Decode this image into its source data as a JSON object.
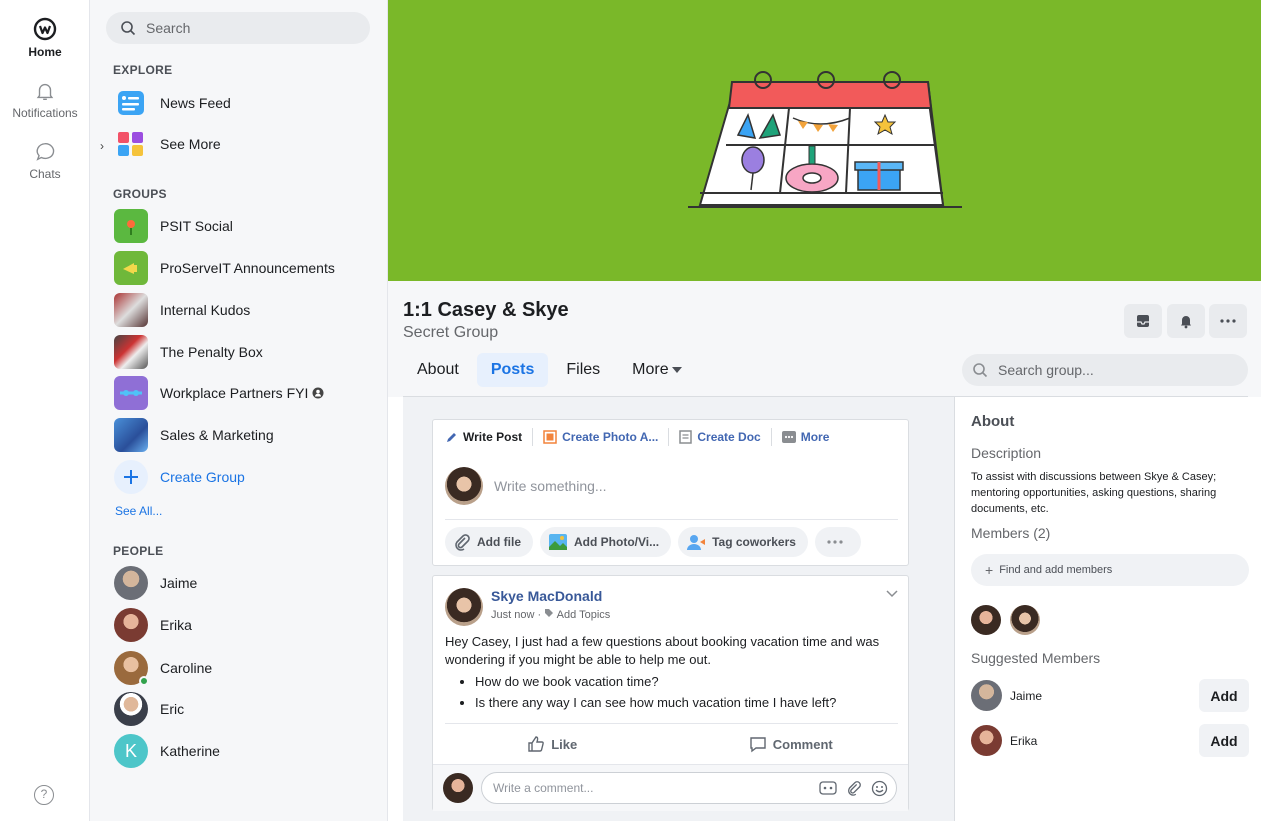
{
  "rail": {
    "home": "Home",
    "notifications": "Notifications",
    "chats": "Chats",
    "help": "?"
  },
  "sidebar": {
    "search_placeholder": "Search",
    "explore_title": "EXPLORE",
    "explore": [
      {
        "label": "News Feed",
        "icon": "news-feed-icon"
      },
      {
        "label": "See More",
        "icon": "see-more-icon"
      }
    ],
    "groups_title": "GROUPS",
    "groups": [
      {
        "label": "PSIT Social",
        "color": "#5bb840"
      },
      {
        "label": "ProServeIT Announcements",
        "color": "#6fb83a"
      },
      {
        "label": "Internal Kudos",
        "color": "#7a3a3a"
      },
      {
        "label": "The Penalty Box",
        "color": "#5a5f6b"
      },
      {
        "label": "Workplace Partners FYI",
        "color": "#8f6fd6"
      },
      {
        "label": "Sales & Marketing",
        "color": "#4a90d9"
      }
    ],
    "create_group": "Create Group",
    "see_all": "See All...",
    "people_title": "PEOPLE",
    "people": [
      {
        "name": "Jaime",
        "color": "#6b6e76"
      },
      {
        "name": "Erika",
        "color": "#7a3b32"
      },
      {
        "name": "Caroline",
        "color": "#9a6a3d"
      },
      {
        "name": "Eric",
        "color": "#3a3f4a"
      },
      {
        "name": "Katherine",
        "initial": "K",
        "color": "#4dc6c9"
      }
    ]
  },
  "group": {
    "title": "1:1 Casey & Skye",
    "subtitle": "Secret Group",
    "tabs": [
      "About",
      "Posts",
      "Files",
      "More"
    ],
    "active_tab": "Posts",
    "search_placeholder": "Search group..."
  },
  "composer": {
    "tabs": [
      "Write Post",
      "Create Photo A...",
      "Create Doc",
      "More"
    ],
    "placeholder": "Write something...",
    "pills": [
      "Add file",
      "Add Photo/Vi...",
      "Tag coworkers"
    ]
  },
  "post": {
    "author": "Skye MacDonald",
    "time": "Just now",
    "topics": "Add Topics",
    "text": "Hey Casey, I just had a few questions about booking vacation time and was wondering if you might be able to help me out.",
    "bullets": [
      "How do we book vacation time?",
      "Is there any way I can see how much vacation time I have left?"
    ],
    "like": "Like",
    "comment": "Comment",
    "comment_placeholder": "Write a comment..."
  },
  "about": {
    "title": "About",
    "description_label": "Description",
    "description": "To assist with discussions between Skye & Casey; mentoring opportunities, asking questions, sharing documents, etc.",
    "members_label": "Members (2)",
    "find_members": "Find and add members",
    "suggested_label": "Suggested Members",
    "suggested": [
      {
        "name": "Jaime",
        "button": "Add"
      },
      {
        "name": "Erika",
        "button": "Add"
      }
    ]
  },
  "colors": {
    "cover": "#7ab829",
    "accent": "#1b74e4",
    "link": "#385898"
  }
}
